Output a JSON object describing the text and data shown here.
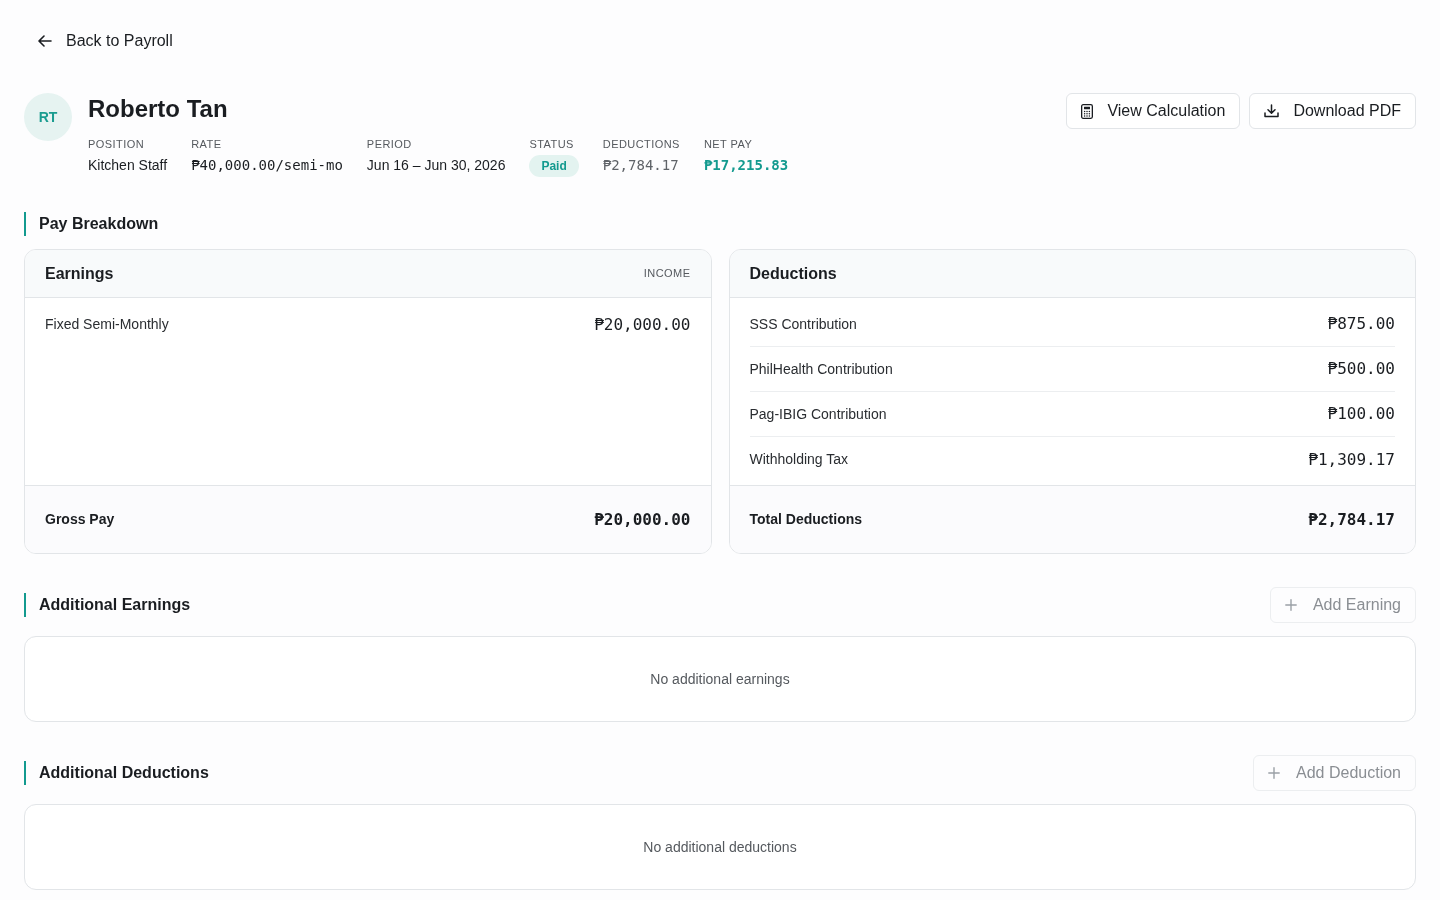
{
  "back_link": {
    "label": "Back to Payroll"
  },
  "employee": {
    "initials": "RT",
    "name": "Roberto Tan",
    "fields": [
      {
        "label": "POSITION",
        "value": "Kitchen Staff",
        "kind": "text"
      },
      {
        "label": "RATE",
        "value": "₱40,000.00/semi-mo",
        "kind": "mono"
      },
      {
        "label": "PERIOD",
        "value": "Jun 16 – Jun 30, 2026",
        "kind": "text"
      },
      {
        "label": "STATUS",
        "value": "Paid",
        "kind": "badge"
      },
      {
        "label": "DEDUCTIONS",
        "value": "₱2,784.17",
        "kind": "muted"
      },
      {
        "label": "NET PAY",
        "value": "₱17,215.83",
        "kind": "accent"
      }
    ]
  },
  "actions": [
    {
      "label": "View Calculation",
      "kind": "calculator"
    },
    {
      "label": "Download PDF",
      "kind": "download"
    }
  ],
  "pay_breakdown": {
    "title": "Pay Breakdown",
    "cards": [
      {
        "title": "Earnings",
        "tag": "INCOME",
        "items": [
          {
            "label": "Fixed Semi-Monthly",
            "amount": "₱20,000.00"
          }
        ],
        "total": {
          "label": "Gross Pay",
          "amount": "₱20,000.00"
        }
      },
      {
        "title": "Deductions",
        "items": [
          {
            "label": "SSS Contribution",
            "amount": "₱875.00"
          },
          {
            "label": "PhilHealth Contribution",
            "amount": "₱500.00"
          },
          {
            "label": "Pag-IBIG Contribution",
            "amount": "₱100.00"
          },
          {
            "label": "Withholding Tax",
            "amount": "₱1,309.17"
          }
        ],
        "total": {
          "label": "Total Deductions",
          "amount": "₱2,784.17"
        }
      }
    ]
  },
  "additional_sections": [
    {
      "title": "Additional Earnings",
      "button": {
        "label": "Add Earning",
        "disabled": true
      },
      "empty_text": "No additional earnings"
    },
    {
      "title": "Additional Deductions",
      "button": {
        "label": "Add Deduction",
        "disabled": true
      },
      "empty_text": "No additional deductions"
    }
  ]
}
